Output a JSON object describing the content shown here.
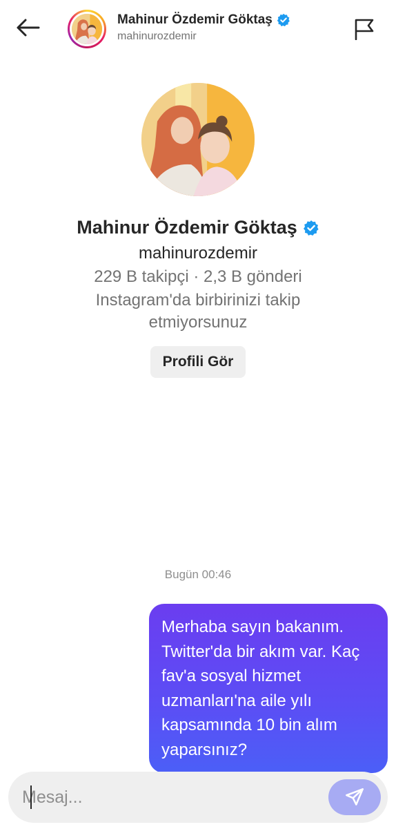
{
  "header": {
    "name": "Mahinur Özdemir Göktaş",
    "username": "mahinurozdemir"
  },
  "profile": {
    "name": "Mahinur Özdemir Göktaş",
    "username": "mahinurozdemir",
    "stats": "229 B takipçi · 2,3 B gönderi",
    "follow_status": "Instagram'da birbirinizi takip etmiyorsunuz",
    "view_profile_label": "Profili Gör"
  },
  "conversation": {
    "timestamp": "Bugün 00:46",
    "messages": [
      {
        "text": "Merhaba sayın bakanım. Twitter'da bir akım var. Kaç fav'a sosyal hizmet uzmanları'na aile yılı kapsamında 10 bin alım yaparsınız?"
      }
    ]
  },
  "composer": {
    "placeholder": "Mesaj..."
  },
  "colors": {
    "verified": "#1d9bf0",
    "bubble_top": "#6b3df0",
    "bubble_bottom": "#4b5ff7",
    "send_button": "#a7abf3"
  },
  "icons": [
    "back-arrow-icon",
    "flag-icon",
    "verified-badge-icon",
    "send-icon"
  ]
}
